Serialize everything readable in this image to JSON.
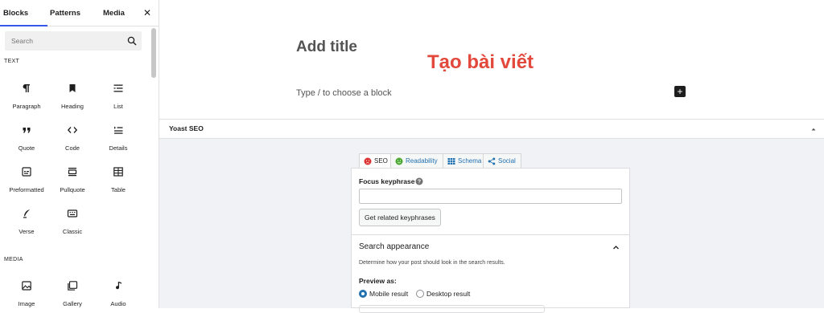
{
  "sidebar": {
    "tabs": [
      {
        "label": "Blocks",
        "active": true
      },
      {
        "label": "Patterns",
        "active": false
      },
      {
        "label": "Media",
        "active": false
      }
    ],
    "close_icon": "close-icon",
    "search": {
      "placeholder": "Search",
      "icon": "search-icon"
    },
    "categories": [
      {
        "label": "TEXT",
        "blocks": [
          {
            "label": "Paragraph",
            "icon": "paragraph-icon"
          },
          {
            "label": "Heading",
            "icon": "heading-icon"
          },
          {
            "label": "List",
            "icon": "list-icon"
          },
          {
            "label": "Quote",
            "icon": "quote-icon"
          },
          {
            "label": "Code",
            "icon": "code-icon"
          },
          {
            "label": "Details",
            "icon": "details-icon"
          },
          {
            "label": "Preformatted",
            "icon": "preformatted-icon"
          },
          {
            "label": "Pullquote",
            "icon": "pullquote-icon"
          },
          {
            "label": "Table",
            "icon": "table-icon"
          },
          {
            "label": "Verse",
            "icon": "verse-icon"
          },
          {
            "label": "Classic",
            "icon": "classic-icon"
          }
        ]
      },
      {
        "label": "MEDIA",
        "blocks": [
          {
            "label": "Image",
            "icon": "image-icon"
          },
          {
            "label": "Gallery",
            "icon": "gallery-icon"
          },
          {
            "label": "Audio",
            "icon": "audio-icon"
          }
        ]
      }
    ]
  },
  "editor": {
    "title_placeholder": "Add title",
    "overlay_text": "Tạo bài viết",
    "appender_text": "Type / to choose a block",
    "add_block_icon": "plus-icon"
  },
  "yoast": {
    "title": "Yoast SEO",
    "tabs": [
      {
        "label": "SEO",
        "icon": "seo-sad-face-icon",
        "active": true
      },
      {
        "label": "Readability",
        "icon": "readability-smile-icon",
        "active": false
      },
      {
        "label": "Schema",
        "icon": "schema-grid-icon",
        "active": false
      },
      {
        "label": "Social",
        "icon": "share-icon",
        "active": false
      }
    ],
    "focus_keyphrase_label": "Focus keyphrase",
    "focus_keyphrase_value": "",
    "related_button": "Get related keyphrases",
    "search_appearance_title": "Search appearance",
    "search_appearance_desc": "Determine how your post should look in the search results.",
    "preview_as_label": "Preview as:",
    "preview_options": [
      {
        "label": "Mobile result",
        "checked": true
      },
      {
        "label": "Desktop result",
        "checked": false
      }
    ]
  },
  "colors": {
    "accent": "#3858e9",
    "overlay_red": "#e2483b",
    "yoast_bg": "#f0f2f6",
    "link_blue": "#2271b1",
    "seo_red": "#dc3232",
    "readability_green": "#7ad03a"
  }
}
